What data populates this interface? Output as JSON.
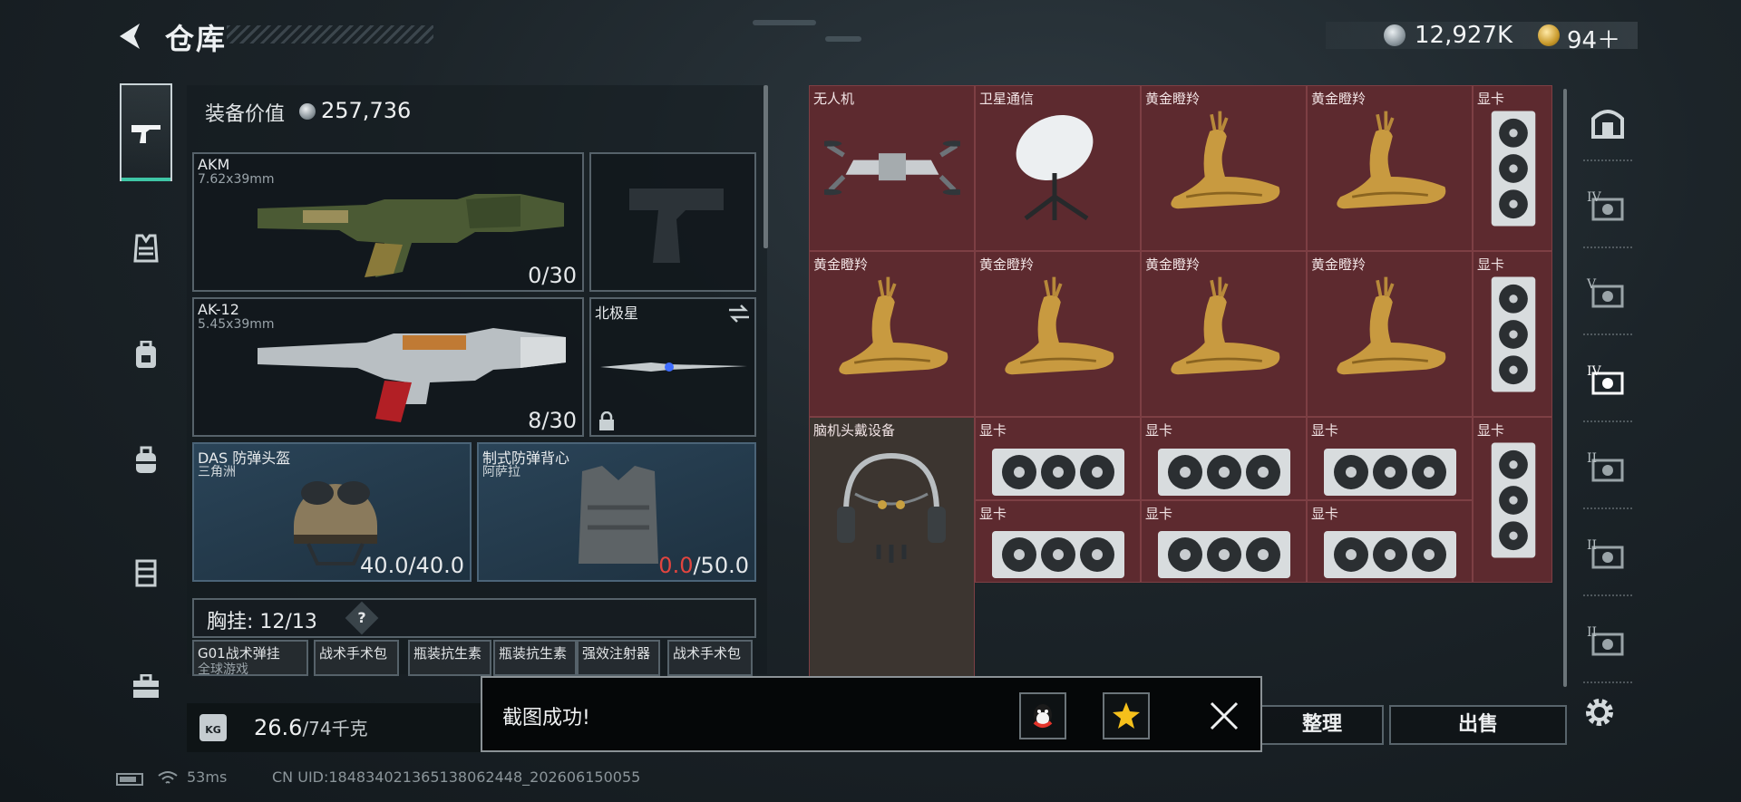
{
  "header": {
    "title": "仓库",
    "coin_value": "12,927K",
    "gold_value": "94＋"
  },
  "rail": {
    "items": [
      "gun-icon",
      "armor-vest-icon",
      "backpack-icon",
      "backpack-alt-icon",
      "chest-rig-icon",
      "briefcase-icon"
    ]
  },
  "equipment": {
    "value_label": "装备价值",
    "value": "257,736",
    "primary": {
      "name": "AKM",
      "caliber": "7.62x39mm",
      "ammo": "0/30"
    },
    "secondary": {
      "name": "AK-12",
      "caliber": "5.45x39mm",
      "ammo": "8/30"
    },
    "melee": {
      "name": "北极星"
    },
    "helmet": {
      "name": "DAS 防弹头盔",
      "source": "三角洲",
      "durability": "40.0/40.0"
    },
    "vest": {
      "name": "制式防弹背心",
      "source": "阿萨拉",
      "durability_current": "0.0",
      "durability_max": "/50.0"
    },
    "chest": {
      "label": "胸挂:",
      "count": "12/13",
      "help": "?"
    },
    "chest_items": [
      {
        "name": "G01战术弹挂",
        "source": "全球游戏"
      },
      {
        "name": "战术手术包"
      },
      {
        "name": "瓶装抗生素"
      },
      {
        "name": "瓶装抗生素"
      },
      {
        "name": "强效注射器"
      },
      {
        "name": "战术手术包"
      }
    ],
    "weight": {
      "icon_label": "KG",
      "current": "26.6",
      "max": "/74千克"
    }
  },
  "loot": {
    "cells": [
      {
        "label": "无人机",
        "icon": "drone-icon"
      },
      {
        "label": "卫星通信",
        "icon": "satellite-dish-icon"
      },
      {
        "label": "黄金瞪羚",
        "icon": "golden-gazelle-icon"
      },
      {
        "label": "黄金瞪羚",
        "icon": "golden-gazelle-icon"
      },
      {
        "label": "显卡",
        "icon": "graphics-card-icon"
      },
      {
        "label": "黄金瞪羚",
        "icon": "golden-gazelle-icon"
      },
      {
        "label": "黄金瞪羚",
        "icon": "golden-gazelle-icon"
      },
      {
        "label": "黄金瞪羚",
        "icon": "golden-gazelle-icon"
      },
      {
        "label": "黄金瞪羚",
        "icon": "golden-gazelle-icon"
      },
      {
        "label": "显卡",
        "icon": "graphics-card-icon"
      },
      {
        "label": "脑机头戴设备",
        "icon": "headset-icon"
      },
      {
        "label": "显卡",
        "icon": "graphics-card-icon"
      },
      {
        "label": "显卡",
        "icon": "graphics-card-icon"
      },
      {
        "label": "显卡",
        "icon": "graphics-card-icon"
      },
      {
        "label": "显卡",
        "icon": "graphics-card-icon"
      },
      {
        "label": "显卡",
        "icon": "graphics-card-icon"
      },
      {
        "label": "显卡",
        "icon": "graphics-card-icon"
      },
      {
        "label": "显卡",
        "icon": "graphics-card-icon"
      }
    ]
  },
  "filters": {
    "items": [
      {
        "icon": "safe-box-icon",
        "tier": ""
      },
      {
        "icon": "tier-item-icon",
        "tier": "IV"
      },
      {
        "icon": "tier-item-icon",
        "tier": "V"
      },
      {
        "icon": "tier-item-icon",
        "tier": "IV"
      },
      {
        "icon": "tier-item-icon",
        "tier": "II"
      },
      {
        "icon": "tier-item-icon",
        "tier": "II"
      },
      {
        "icon": "tier-item-icon",
        "tier": "II"
      }
    ]
  },
  "actions": {
    "organize": "整理",
    "sell": "出售"
  },
  "toast": {
    "message": "截图成功!"
  },
  "status": {
    "ping": "53ms",
    "uid": "CN UID:18483402136513806244​8_202606150055"
  },
  "colors": {
    "loot_red": "#5d2a2f",
    "accent_green": "#3fc6a6",
    "warning_red": "#e2453f",
    "slot_blue": "#2a4458"
  }
}
